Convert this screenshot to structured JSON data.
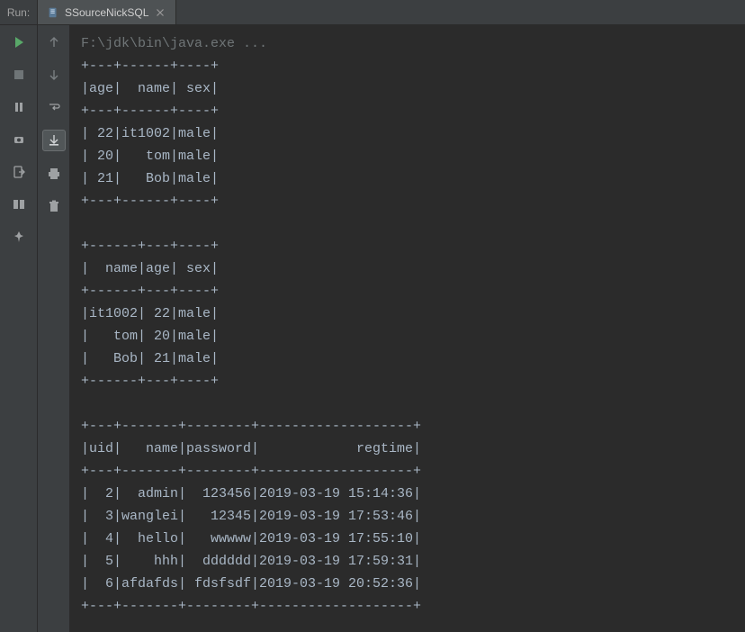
{
  "topbar": {
    "run_label": "Run:",
    "tab_title": "SSourceNickSQL"
  },
  "console": {
    "command": "F:\\jdk\\bin\\java.exe ...",
    "lines": [
      "+---+------+----+",
      "|age|  name| sex|",
      "+---+------+----+",
      "| 22|it1002|male|",
      "| 20|   tom|male|",
      "| 21|   Bob|male|",
      "+---+------+----+",
      "",
      "+------+---+----+",
      "|  name|age| sex|",
      "+------+---+----+",
      "|it1002| 22|male|",
      "|   tom| 20|male|",
      "|   Bob| 21|male|",
      "+------+---+----+",
      "",
      "+---+-------+--------+-------------------+",
      "|uid|   name|password|            regtime|",
      "+---+-------+--------+-------------------+",
      "|  2|  admin|  123456|2019-03-19 15:14:36|",
      "|  3|wanglei|   12345|2019-03-19 17:53:46|",
      "|  4|  hello|   wwwww|2019-03-19 17:55:10|",
      "|  5|    hhh|  dddddd|2019-03-19 17:59:31|",
      "|  6|afdafds| fdsfsdf|2019-03-19 20:52:36|",
      "+---+-------+--------+-------------------+"
    ]
  },
  "chart_data": [
    {
      "type": "table",
      "columns": [
        "age",
        "name",
        "sex"
      ],
      "rows": [
        [
          22,
          "it1002",
          "male"
        ],
        [
          20,
          "tom",
          "male"
        ],
        [
          21,
          "Bob",
          "male"
        ]
      ]
    },
    {
      "type": "table",
      "columns": [
        "name",
        "age",
        "sex"
      ],
      "rows": [
        [
          "it1002",
          22,
          "male"
        ],
        [
          "tom",
          20,
          "male"
        ],
        [
          "Bob",
          21,
          "male"
        ]
      ]
    },
    {
      "type": "table",
      "columns": [
        "uid",
        "name",
        "password",
        "regtime"
      ],
      "rows": [
        [
          2,
          "admin",
          "123456",
          "2019-03-19 15:14:36"
        ],
        [
          3,
          "wanglei",
          "12345",
          "2019-03-19 17:53:46"
        ],
        [
          4,
          "hello",
          "wwwww",
          "2019-03-19 17:55:10"
        ],
        [
          5,
          "hhh",
          "dddddd",
          "2019-03-19 17:59:31"
        ],
        [
          6,
          "afdafds",
          "fdsfsdf",
          "2019-03-19 20:52:36"
        ]
      ]
    }
  ]
}
